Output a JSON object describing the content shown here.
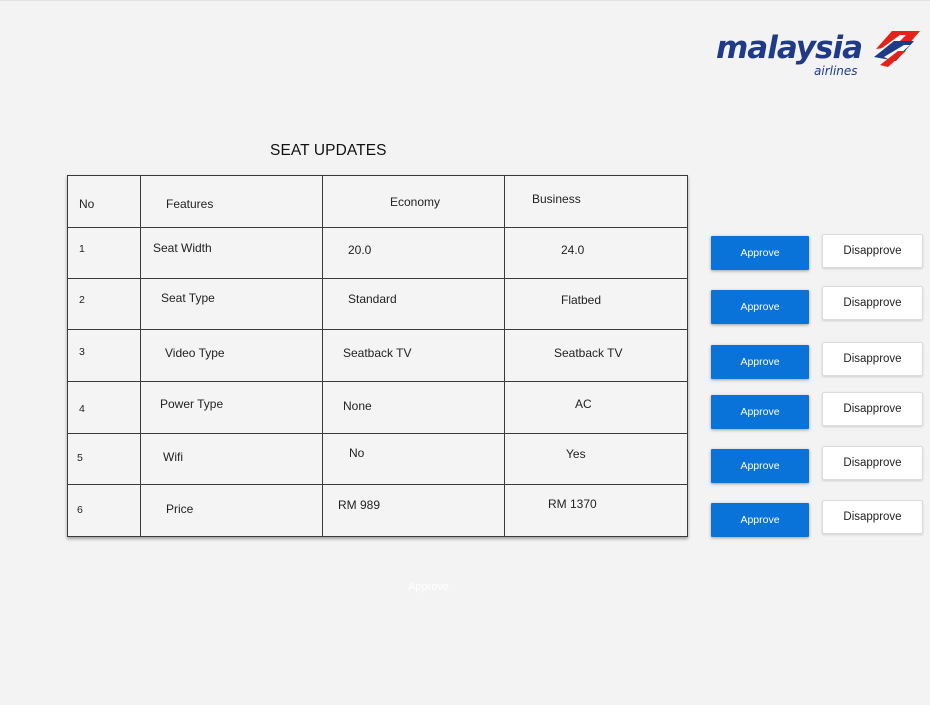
{
  "brand": {
    "name": "malaysia",
    "sub": "airlines"
  },
  "page_title": "SEAT UPDATES",
  "table": {
    "headers": [
      "No",
      "Features",
      "Economy",
      "Business"
    ],
    "rows": [
      [
        "1",
        "Seat Width",
        "20.0",
        "24.0"
      ],
      [
        "2",
        "Seat Type",
        "Standard",
        "Flatbed"
      ],
      [
        "3",
        "Video Type",
        "Seatback TV",
        "Seatback TV"
      ],
      [
        "4",
        "Power Type",
        "None",
        "AC"
      ],
      [
        "5",
        "Wifi",
        "No",
        "Yes"
      ],
      [
        "6",
        "Price",
        "RM 989",
        "RM 1370"
      ]
    ]
  },
  "actions": {
    "approve_label": "Approve",
    "disapprove_label": "Disapprove"
  },
  "ghost_label": "Approve",
  "colors": {
    "accent": "#0a73d9",
    "brand_blue": "#1f3b87",
    "brand_red": "#e2231a",
    "background": "#f3f3f3"
  }
}
